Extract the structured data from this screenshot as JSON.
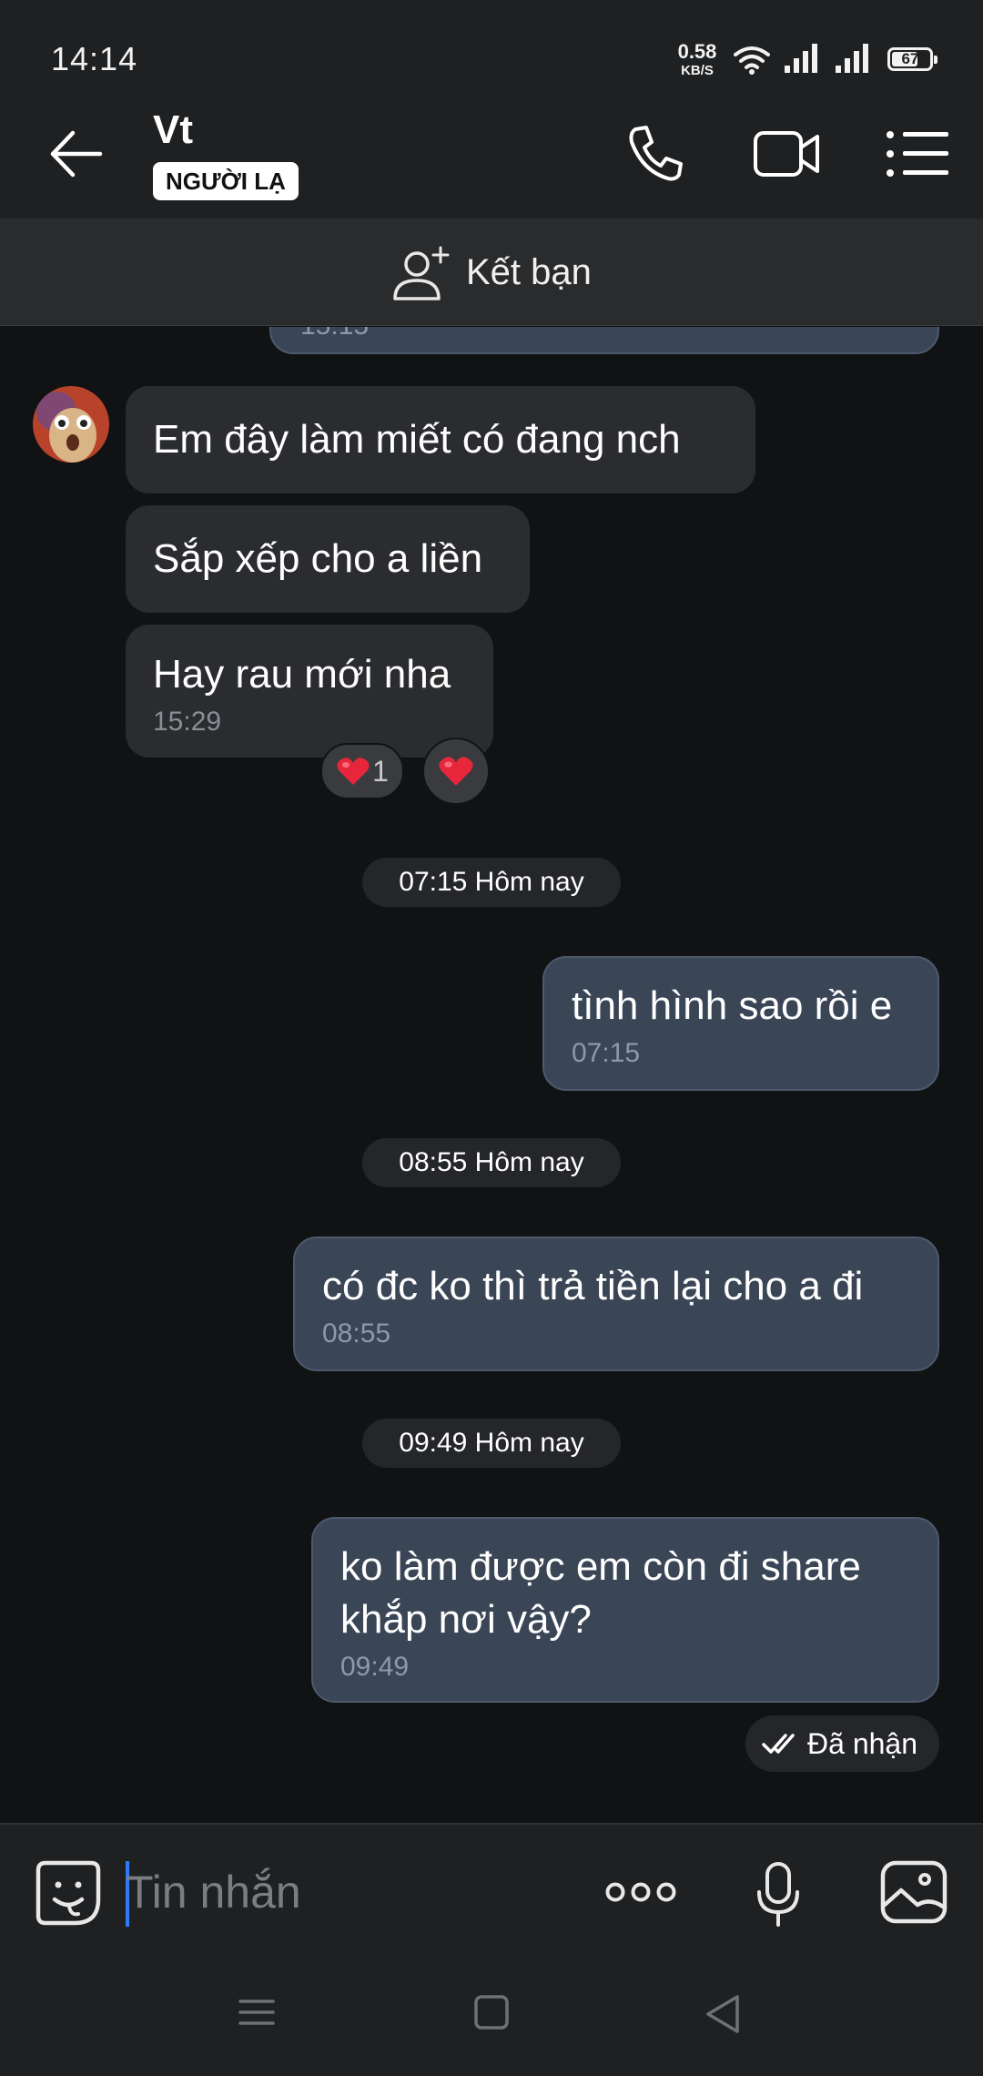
{
  "status_bar": {
    "time": "14:14",
    "net_speed_value": "0.58",
    "net_speed_unit": "KB/S",
    "battery": "67",
    "icons": [
      "wifi-icon",
      "signal-icon",
      "signal-icon",
      "battery-icon"
    ]
  },
  "header": {
    "contact_name": "Vt",
    "badge": "NGƯỜI LẠ",
    "icons": [
      "back-arrow-icon",
      "phone-icon",
      "video-camera-icon",
      "menu-list-icon"
    ]
  },
  "friend_bar": {
    "label": "Kết bạn",
    "icon": "add-person-icon"
  },
  "messages": {
    "partial_prev_time": "15:15",
    "incoming": [
      {
        "text": "Em đây làm miết có đang nch"
      },
      {
        "text": "Sắp xếp cho a liền"
      },
      {
        "text": "Hay rau mới nha",
        "time": "15:29"
      }
    ],
    "reaction_count": "1",
    "reaction_icon": "heart-icon",
    "day_1": {
      "label": "07:15 Hôm nay"
    },
    "outgoing_1": {
      "text": "tình hình sao rồi e",
      "time": "07:15"
    },
    "day_2": {
      "label": "08:55 Hôm nay"
    },
    "outgoing_2": {
      "text": "có đc ko thì trả tiền lại cho a đi",
      "time": "08:55"
    },
    "day_3": {
      "label": "09:49 Hôm nay"
    },
    "outgoing_3": {
      "text": "ko làm được em còn đi share khắp nơi vậy?",
      "time": "09:49"
    },
    "delivery_status": "Đã nhận"
  },
  "input_bar": {
    "placeholder": "Tin nhắn",
    "icons": [
      "sticker-icon",
      "more-dots-icon",
      "microphone-icon",
      "image-icon"
    ]
  },
  "nav_bar": {
    "icons": [
      "recent-apps-icon",
      "home-icon",
      "back-icon"
    ]
  },
  "colors": {
    "background": "#111214",
    "bar": "#1f2022",
    "incoming_bubble": "#2b2c2f",
    "outgoing_bubble": "#3a4556",
    "heart": "#e8263b",
    "caret": "#2f7bf6"
  }
}
